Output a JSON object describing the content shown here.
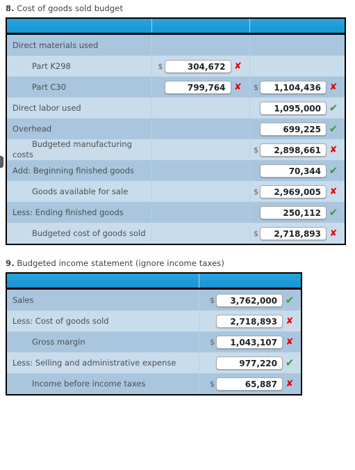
{
  "sections": [
    {
      "number": "8.",
      "title": "Cost of goods sold budget",
      "table_name": "table-cogs",
      "columns": 3,
      "rows": [
        {
          "label": "Direct materials used",
          "indent": false,
          "shade": "a",
          "col2": null,
          "col3": null
        },
        {
          "label": "Part K298",
          "indent": true,
          "shade": "b",
          "col2": {
            "dollar": "$",
            "value": "304,672",
            "mark": "wrong",
            "mark_glyph": "✘"
          },
          "col3": null
        },
        {
          "label": "Part C30",
          "indent": true,
          "shade": "a",
          "col2": {
            "dollar": "",
            "value": "799,764",
            "mark": "wrong",
            "mark_glyph": "✘"
          },
          "col3": {
            "dollar": "$",
            "value": "1,104,436",
            "mark": "wrong",
            "mark_glyph": "✘"
          }
        },
        {
          "label": "Direct labor used",
          "indent": false,
          "shade": "b",
          "col2": null,
          "col3": {
            "dollar": "",
            "value": "1,095,000",
            "mark": "right",
            "mark_glyph": "✔"
          }
        },
        {
          "label": "Overhead",
          "indent": false,
          "shade": "a",
          "col2": null,
          "col3": {
            "dollar": "",
            "value": "699,225",
            "mark": "right",
            "mark_glyph": "✔"
          }
        },
        {
          "label": "Budgeted manufacturing costs",
          "indent": true,
          "shade": "b",
          "col2": null,
          "col3": {
            "dollar": "$",
            "value": "2,898,661",
            "mark": "wrong",
            "mark_glyph": "✘"
          }
        },
        {
          "label": "Add: Beginning finished goods",
          "indent": false,
          "shade": "a",
          "col2": null,
          "col3": {
            "dollar": "",
            "value": "70,344",
            "mark": "right",
            "mark_glyph": "✔"
          }
        },
        {
          "label": "Goods available for sale",
          "indent": true,
          "shade": "b",
          "col2": null,
          "col3": {
            "dollar": "$",
            "value": "2,969,005",
            "mark": "wrong",
            "mark_glyph": "✘"
          }
        },
        {
          "label": "Less: Ending finished goods",
          "indent": false,
          "shade": "a",
          "col2": null,
          "col3": {
            "dollar": "",
            "value": "250,112",
            "mark": "right",
            "mark_glyph": "✔"
          }
        },
        {
          "label": "Budgeted cost of goods sold",
          "indent": true,
          "shade": "b",
          "col2": null,
          "col3": {
            "dollar": "$",
            "value": "2,718,893",
            "mark": "wrong",
            "mark_glyph": "✘"
          }
        }
      ]
    },
    {
      "number": "9.",
      "title": "Budgeted income statement (ignore income taxes)",
      "table_name": "table-income",
      "columns": 2,
      "rows": [
        {
          "label": "Sales",
          "indent": false,
          "shade": "a",
          "col2": {
            "dollar": "$",
            "value": "3,762,000",
            "mark": "right",
            "mark_glyph": "✔"
          },
          "col3": null
        },
        {
          "label": "Less: Cost of goods sold",
          "indent": false,
          "shade": "b",
          "col2": {
            "dollar": "",
            "value": "2,718,893",
            "mark": "wrong",
            "mark_glyph": "✘"
          },
          "col3": null
        },
        {
          "label": "Gross margin",
          "indent": true,
          "shade": "a",
          "col2": {
            "dollar": "$",
            "value": "1,043,107",
            "mark": "wrong",
            "mark_glyph": "✘"
          },
          "col3": null
        },
        {
          "label": "Less: Selling and administrative expense",
          "indent": false,
          "shade": "b",
          "col2": {
            "dollar": "",
            "value": "977,220",
            "mark": "right",
            "mark_glyph": "✔"
          },
          "col3": null
        },
        {
          "label": "Income before income taxes",
          "indent": true,
          "shade": "a",
          "col2": {
            "dollar": "$",
            "value": "65,887",
            "mark": "wrong",
            "mark_glyph": "✘"
          },
          "col3": null
        }
      ]
    }
  ],
  "colors": {
    "header_blue": "#1e9bd7",
    "row_dark": "#a9c6de",
    "row_light": "#c9dcec",
    "mark_wrong": "#e00505",
    "mark_right": "#3d9a3d",
    "border": "#000000"
  }
}
